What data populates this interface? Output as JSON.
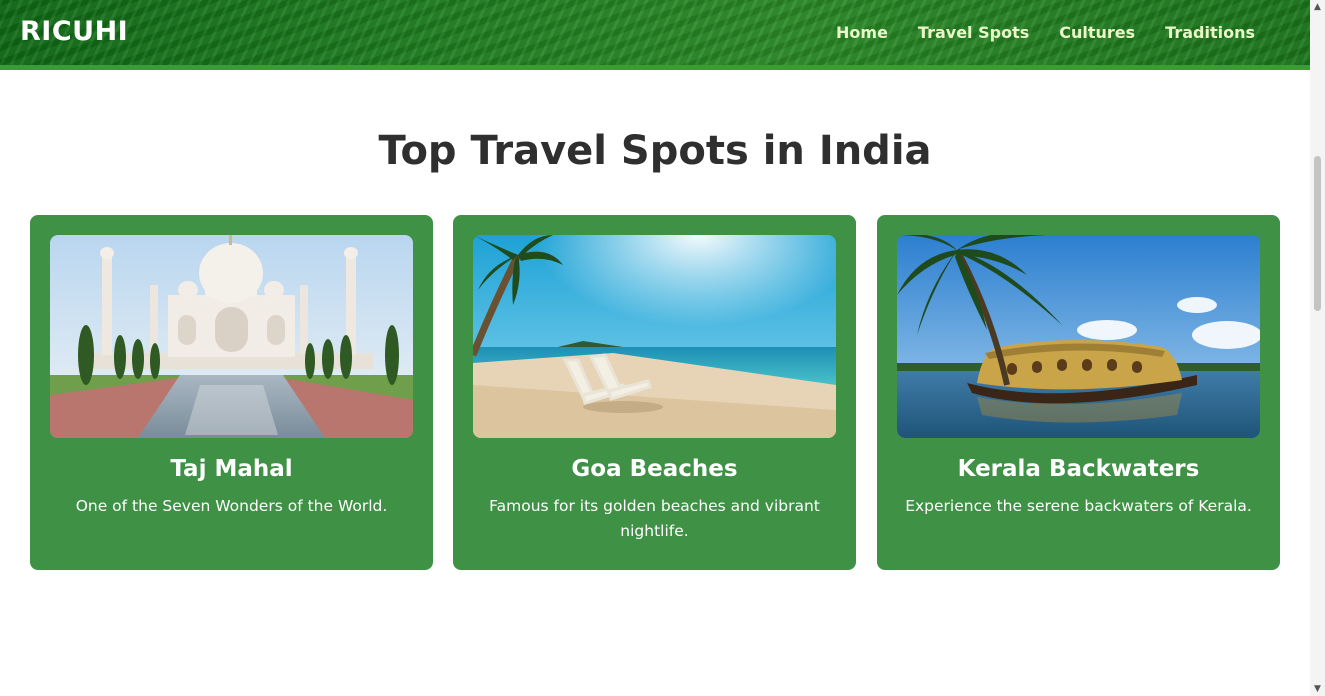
{
  "header": {
    "logo": "RICUHI",
    "nav": [
      "Home",
      "Travel Spots",
      "Cultures",
      "Traditions"
    ]
  },
  "main": {
    "title": "Top Travel Spots in India",
    "cards": [
      {
        "title": "Taj Mahal",
        "description": "One of the Seven Wonders of the World."
      },
      {
        "title": "Goa Beaches",
        "description": "Famous for its golden beaches and vibrant nightlife."
      },
      {
        "title": "Kerala Backwaters",
        "description": "Experience the serene backwaters of Kerala."
      }
    ]
  },
  "colors": {
    "header_green": "#1d7d1f",
    "card_green": "#3e9145",
    "nav_text": "#e9f7c8",
    "title_text": "#2f2f2f"
  }
}
